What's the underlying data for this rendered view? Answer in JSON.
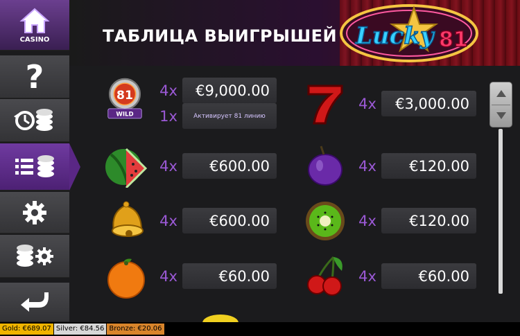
{
  "sidebar": {
    "home_label": "CASINO",
    "items": [
      {
        "name": "help",
        "icon": "question-icon"
      },
      {
        "name": "history",
        "icon": "history-icon"
      },
      {
        "name": "paytable",
        "icon": "paytable-icon",
        "active": true
      },
      {
        "name": "settings",
        "icon": "gear-icon"
      },
      {
        "name": "bet-settings",
        "icon": "coins-gear-icon"
      },
      {
        "name": "back",
        "icon": "back-arrow-icon"
      }
    ]
  },
  "header": {
    "title": "ТАБЛИЦА ВЫИГРЫШЕЙ",
    "logo_text": "Lucky",
    "logo_number": "81"
  },
  "paytable": {
    "left": [
      {
        "symbol": "wild-81",
        "badge": "WILD",
        "rows": [
          {
            "mult": "4x",
            "value": "€9,000.00"
          },
          {
            "mult": "1x",
            "value": "Активирует 81 линию"
          }
        ]
      },
      {
        "symbol": "watermelon",
        "rows": [
          {
            "mult": "4x",
            "value": "€600.00"
          }
        ]
      },
      {
        "symbol": "bell",
        "rows": [
          {
            "mult": "4x",
            "value": "€600.00"
          }
        ]
      },
      {
        "symbol": "orange",
        "rows": [
          {
            "mult": "4x",
            "value": "€60.00"
          }
        ]
      }
    ],
    "right": [
      {
        "symbol": "seven",
        "rows": [
          {
            "mult": "4x",
            "value": "€3,000.00"
          }
        ]
      },
      {
        "symbol": "plum",
        "rows": [
          {
            "mult": "4x",
            "value": "€120.00"
          }
        ]
      },
      {
        "symbol": "kiwi",
        "rows": [
          {
            "mult": "4x",
            "value": "€120.00"
          }
        ]
      },
      {
        "symbol": "cherries",
        "rows": [
          {
            "mult": "4x",
            "value": "€60.00"
          }
        ]
      }
    ]
  },
  "jackpots": {
    "gold": "Gold: €689.07",
    "silver": "Silver: €84.56",
    "bronze": "Bronze: €20.06"
  },
  "colors": {
    "accent": "#9b59d6",
    "active_tab": "#5a2785",
    "gold": "#f0b400",
    "silver": "#d7d7d7",
    "bronze": "#d9852b"
  }
}
